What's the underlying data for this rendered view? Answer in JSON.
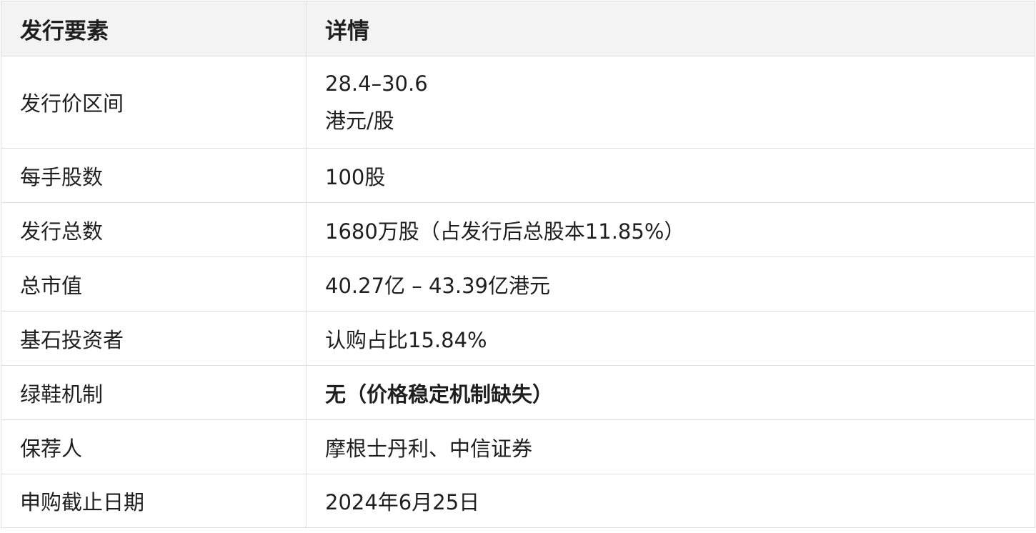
{
  "table": {
    "headers": [
      "发行要素",
      "详情"
    ],
    "rows": [
      {
        "label": "发行价区间",
        "value_line1": "28.4–30.6",
        "value_line2": "港元/股"
      },
      {
        "label": "每手股数",
        "value": "100股"
      },
      {
        "label": "发行总数",
        "value": "1680万股（占发行后总股本11.85%）"
      },
      {
        "label": "总市值",
        "value": "40.27亿 – 43.39亿港元"
      },
      {
        "label": "基石投资者",
        "value": "认购占比15.84%"
      },
      {
        "label": "绿鞋机制",
        "value": "无（价格稳定机制缺失）"
      },
      {
        "label": "保荐人",
        "value": "摩根士丹利、中信证券"
      },
      {
        "label": "申购截止日期",
        "value": "2024年6月25日"
      }
    ]
  }
}
